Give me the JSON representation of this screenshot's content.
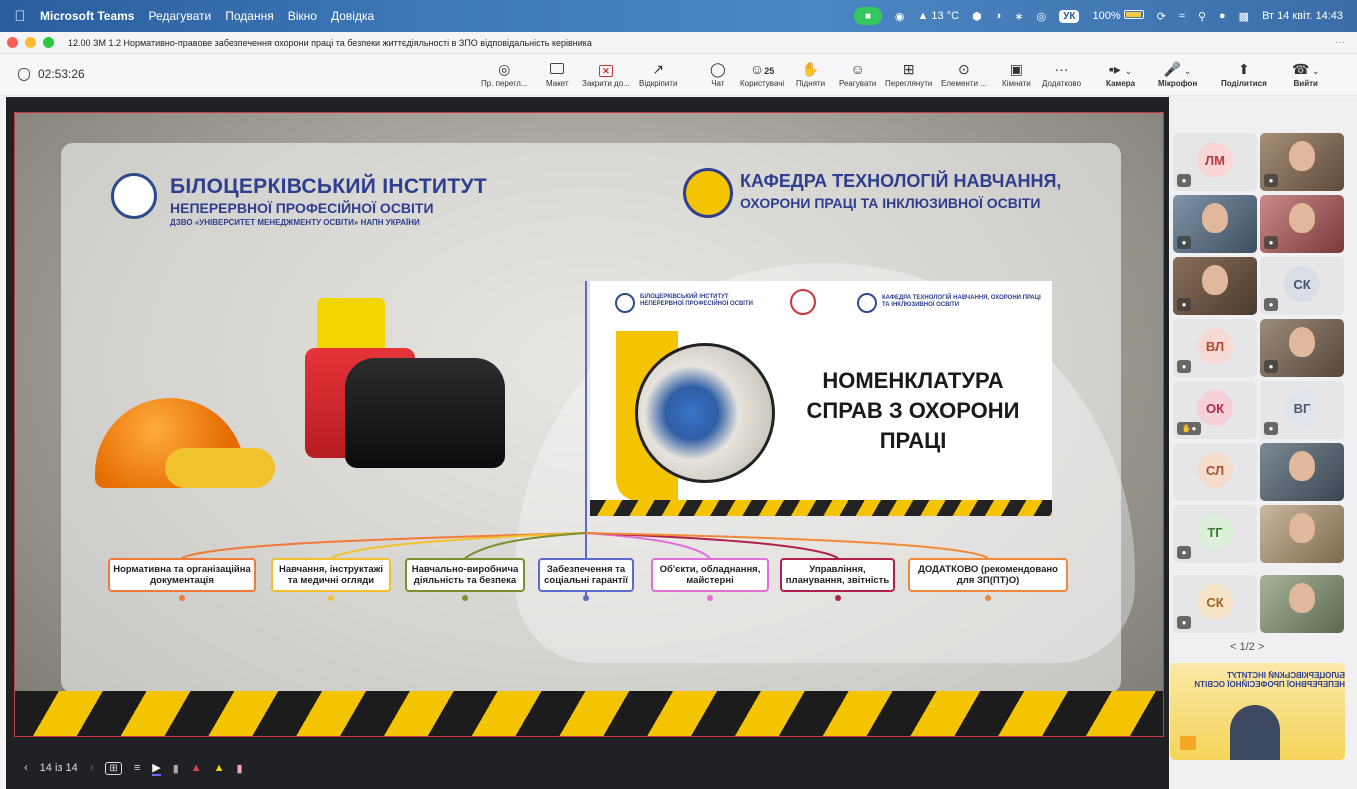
{
  "menubar": {
    "app": "Microsoft Teams",
    "menus": [
      "Редагувати",
      "Подання",
      "Вікно",
      "Довідка"
    ],
    "temp": "13 °C",
    "lang": "УК",
    "battery": "100%",
    "datetime": "Вт 14 квіт.  14:43"
  },
  "window": {
    "title": "12.00 ЗМ 1.2 Нормативно-правове забезпечення охорони праці та безпеки життєдіяльності в ЗПО відповідальність керівника"
  },
  "toolbar": {
    "timer": "02:53:26",
    "items": [
      {
        "label": "Пр. перегл...",
        "icon": "eye-icon"
      },
      {
        "label": "Макет",
        "icon": "layout-icon"
      },
      {
        "label": "Закрити до...",
        "icon": "close-share-icon"
      },
      {
        "label": "Відкріпити",
        "icon": "pop-out-icon"
      },
      {
        "label": "Чат",
        "icon": "chat-icon"
      },
      {
        "label": "Користувачі",
        "icon": "people-icon",
        "badge": "25"
      },
      {
        "label": "Підняти",
        "icon": "raise-hand-icon"
      },
      {
        "label": "Реагувати",
        "icon": "react-icon"
      },
      {
        "label": "Переглянути",
        "icon": "view-icon"
      },
      {
        "label": "Елементи ...",
        "icon": "apps-icon"
      },
      {
        "label": "Кімнати",
        "icon": "rooms-icon"
      },
      {
        "label": "Додатково",
        "icon": "more-icon"
      }
    ],
    "camera": "Камера",
    "mic": "Мікрофон",
    "share": "Поділитися",
    "leave": "Вийти"
  },
  "slide": {
    "institute_title": "БІЛОЦЕРКІВСЬКИЙ ІНСТИТУТ",
    "institute_sub1": "НЕПЕРЕРВНОЇ ПРОФЕСІЙНОЇ ОСВІТИ",
    "institute_sub2": "ДЗВО «УНІВЕРСИТЕТ МЕНЕДЖМЕНТУ ОСВІТИ» НАПН УКРАЇНИ",
    "dept_line1": "КАФЕДРА ТЕХНОЛОГІЙ НАВЧАННЯ,",
    "dept_line2": "ОХОРОНИ ПРАЦІ ТА ІНКЛЮЗИВНОЇ ОСВІТИ",
    "inner_inst": "БІЛОЦЕРКІВСЬКИЙ ІНСТИТУТ НЕПЕРЕРВНОЇ ПРОФЕСІЙНОЇ ОСВІТИ",
    "inner_dept": "КАФЕДРА ТЕХНОЛОГІЙ НАВЧАННЯ, ОХОРОНИ ПРАЦІ ТА ІНКЛЮЗИВНОЇ ОСВІТИ",
    "main_title_l1": "НОМЕНКЛАТУРА",
    "main_title_l2": "СПРАВ З ОХОРОНИ",
    "main_title_l3": "ПРАЦІ",
    "categories": [
      {
        "label": "Нормативна та організаційна документація",
        "color": "#f07a3a"
      },
      {
        "label": "Навчання, інструктажі та медичні огляди",
        "color": "#f2c12e"
      },
      {
        "label": "Навчально-виробнича діяльність та безпека",
        "color": "#7a8f2f"
      },
      {
        "label": "Забезпечення та соціальні гарантії",
        "color": "#5b6cc8"
      },
      {
        "label": "Об'єкти, обладнання, майстерні",
        "color": "#e070d8"
      },
      {
        "label": "Управління, планування, звітність",
        "color": "#b0204a"
      },
      {
        "label": "ДОДАТКОВО (рекомендовано для ЗП(ПТ)О)",
        "color": "#f08a3a"
      }
    ]
  },
  "controls": {
    "page": "14 із 14"
  },
  "roster": {
    "tiles": [
      {
        "initials": "ЛМ",
        "bg": "#f6d6d6",
        "fg": "#b33c3c"
      },
      {
        "initials": "",
        "video": true
      },
      {
        "initials": "",
        "video": true
      },
      {
        "initials": "",
        "video": true
      },
      {
        "initials": "",
        "video": true
      },
      {
        "initials": "СК",
        "bg": "#d9dde6",
        "fg": "#44546e"
      },
      {
        "initials": "ВЛ",
        "bg": "#f6d9d3",
        "fg": "#b3482f"
      },
      {
        "initials": "",
        "video": true
      },
      {
        "initials": "ОК",
        "bg": "#f6d0d8",
        "fg": "#b32a4a"
      },
      {
        "initials": "ВГ",
        "bg": "#dfe3ea",
        "fg": "#4b5a72"
      },
      {
        "initials": "СЛ",
        "bg": "#f4dccd",
        "fg": "#a8532b"
      },
      {
        "initials": "",
        "video": true
      },
      {
        "initials": "ТГ",
        "bg": "#dcefd8",
        "fg": "#3f7a37"
      },
      {
        "initials": "",
        "video": true
      },
      {
        "initials": "СК",
        "bg": "#f6e4c9",
        "fg": "#a0621c"
      },
      {
        "initials": "",
        "video": true
      }
    ],
    "pager": "1/2",
    "share_thumb_text": "БІЛОЦЕРКІВСЬКИЙ ІНСТИТУТ НЕПЕРЕРВНОЇ ПРОФЕСІЙНОЇ ОСВІТИ"
  }
}
